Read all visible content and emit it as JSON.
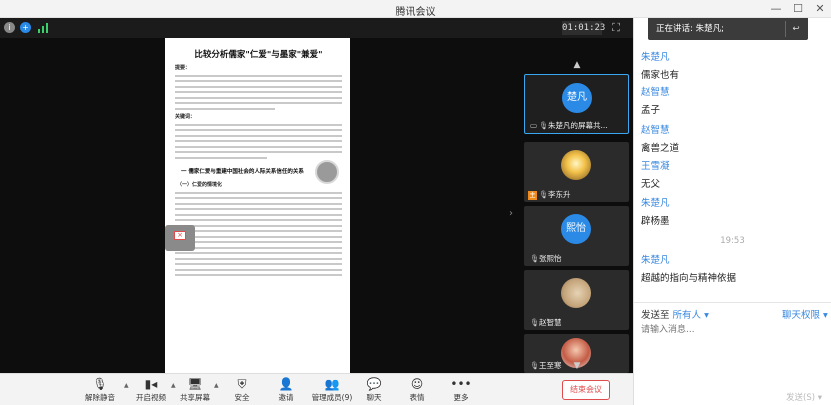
{
  "window": {
    "title": "腾讯会议",
    "controls": {
      "minimize": "—",
      "maximize": "☐",
      "close": "✕"
    }
  },
  "meeting": {
    "timer": "01:01:23",
    "status_icons": {
      "info": "i",
      "shield": "+"
    }
  },
  "shared_doc": {
    "title": "比较分析儒家\"仁爱\"与墨家\"兼爱\"",
    "abstract_label": "提要：",
    "keywords_label": "关键词：",
    "section_heading": "一 儒家仁爱与重建中国社会的人际关系信任的关系",
    "subsection_heading": "（一）仁爱的情境化"
  },
  "video_tiles": [
    {
      "name": "朱楚凡的屏幕共...",
      "avatar_text": "楚凡",
      "avatar_style": "blue",
      "active": true,
      "host": false,
      "screen": true
    },
    {
      "name": "李东升",
      "avatar_text": "",
      "avatar_style": "img-gold",
      "active": false,
      "host": true,
      "screen": false
    },
    {
      "name": "张熙怡",
      "avatar_text": "熙怡",
      "avatar_style": "blue",
      "active": false,
      "host": false,
      "screen": false
    },
    {
      "name": "赵智慧",
      "avatar_text": "",
      "avatar_style": "img-sand",
      "active": false,
      "host": false,
      "screen": false
    },
    {
      "name": "王至寒",
      "avatar_text": "",
      "avatar_style": "img-girl",
      "active": false,
      "host": false,
      "screen": false
    }
  ],
  "toolbar": {
    "mute": "解除静音",
    "video": "开启视频",
    "share": "共享屏幕",
    "security": "安全",
    "invite": "邀请",
    "members": "管理成员(9)",
    "chat": "聊天",
    "reactions": "表情",
    "more": "更多",
    "end": "结束会议"
  },
  "chat": {
    "speaking_label": "正在讲话: 朱楚凡;",
    "messages": [
      {
        "sender": "朱楚凡",
        "text": "儒家也有"
      },
      {
        "sender": "赵智慧",
        "text": "孟子"
      },
      {
        "sender": "赵智慧",
        "text": "禽兽之道"
      },
      {
        "sender": "王雪凝",
        "text": "无父"
      },
      {
        "sender": "朱楚凡",
        "text": "辟杨墨"
      }
    ],
    "time_divider": "19:53",
    "messages_after": [
      {
        "sender": "朱楚凡",
        "text": "超越的指向与精神依据"
      }
    ],
    "send_to_label": "发送至",
    "send_to_target": "所有人",
    "permission_label": "聊天权限",
    "input_placeholder": "请输入消息...",
    "send_button": "发送(S)"
  },
  "colors": {
    "accent_blue": "#3a89e0",
    "end_red": "#e04b4b",
    "stage_bg": "#0d0d0d",
    "signal_green": "#3ccf6b"
  }
}
